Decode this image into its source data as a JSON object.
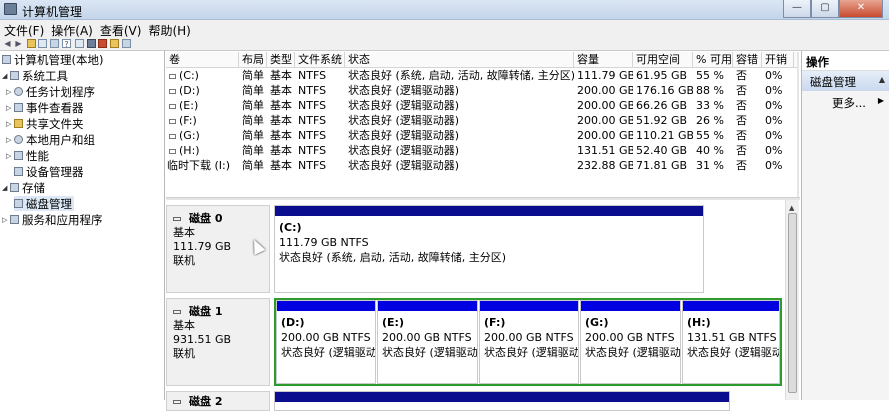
{
  "window": {
    "title": "计算机管理",
    "controls": [
      "—",
      "▢",
      "✕"
    ]
  },
  "menu": [
    "文件(F)",
    "操作(A)",
    "查看(V)",
    "帮助(H)"
  ],
  "tree": {
    "items": [
      {
        "label": "计算机管理(本地)",
        "level": 0
      },
      {
        "label": "系统工具",
        "level": 1
      },
      {
        "label": "任务计划程序",
        "level": 2
      },
      {
        "label": "事件查看器",
        "level": 2
      },
      {
        "label": "共享文件夹",
        "level": 2
      },
      {
        "label": "本地用户和组",
        "level": 2
      },
      {
        "label": "性能",
        "level": 2
      },
      {
        "label": "设备管理器",
        "level": 2
      },
      {
        "label": "存储",
        "level": 1
      },
      {
        "label": "磁盘管理",
        "level": 2,
        "selected": true
      },
      {
        "label": "服务和应用程序",
        "level": 1
      }
    ]
  },
  "volumes": {
    "columns": [
      "卷",
      "布局",
      "类型",
      "文件系统",
      "状态",
      "容量",
      "可用空间",
      "% 可用",
      "容错",
      "开销"
    ],
    "rows": [
      [
        "(C:)",
        "简单",
        "基本",
        "NTFS",
        "状态良好 (系统, 启动, 活动, 故障转储, 主分区)",
        "111.79 GB",
        "61.95 GB",
        "55 %",
        "否",
        "0%"
      ],
      [
        "(D:)",
        "简单",
        "基本",
        "NTFS",
        "状态良好 (逻辑驱动器)",
        "200.00 GB",
        "176.16 GB",
        "88 %",
        "否",
        "0%"
      ],
      [
        "(E:)",
        "简单",
        "基本",
        "NTFS",
        "状态良好 (逻辑驱动器)",
        "200.00 GB",
        "66.26 GB",
        "33 %",
        "否",
        "0%"
      ],
      [
        "(F:)",
        "简单",
        "基本",
        "NTFS",
        "状态良好 (逻辑驱动器)",
        "200.00 GB",
        "51.92 GB",
        "26 %",
        "否",
        "0%"
      ],
      [
        "(G:)",
        "简单",
        "基本",
        "NTFS",
        "状态良好 (逻辑驱动器)",
        "200.00 GB",
        "110.21 GB",
        "55 %",
        "否",
        "0%"
      ],
      [
        "(H:)",
        "简单",
        "基本",
        "NTFS",
        "状态良好 (逻辑驱动器)",
        "131.51 GB",
        "52.40 GB",
        "40 %",
        "否",
        "0%"
      ],
      [
        "临时下载 (I:)",
        "简单",
        "基本",
        "NTFS",
        "状态良好 (逻辑驱动器)",
        "232.88 GB",
        "71.81 GB",
        "31 %",
        "否",
        "0%"
      ]
    ]
  },
  "disks": [
    {
      "name": "磁盘 0",
      "type": "基本",
      "size": "111.79 GB",
      "status": "联机",
      "partitions": [
        {
          "letter": "(C:)",
          "size": "111.79 GB NTFS",
          "status": "状态良好 (系统, 启动, 活动, 故障转储, 主分区)"
        }
      ]
    },
    {
      "name": "磁盘 1",
      "type": "基本",
      "size": "931.51 GB",
      "status": "联机",
      "partitions": [
        {
          "letter": "(D:)",
          "size": "200.00 GB NTFS",
          "status": "状态良好 (逻辑驱动器)"
        },
        {
          "letter": "(E:)",
          "size": "200.00 GB NTFS",
          "status": "状态良好 (逻辑驱动器)"
        },
        {
          "letter": "(F:)",
          "size": "200.00 GB NTFS",
          "status": "状态良好 (逻辑驱动器)"
        },
        {
          "letter": "(G:)",
          "size": "200.00 GB NTFS",
          "status": "状态良好 (逻辑驱动器)"
        },
        {
          "letter": "(H:)",
          "size": "131.51 GB NTFS",
          "status": "状态良好 (逻辑驱动器)"
        }
      ]
    },
    {
      "name": "磁盘 2"
    }
  ],
  "actions": {
    "header": "操作",
    "section": "磁盘管理",
    "more": "更多..."
  }
}
